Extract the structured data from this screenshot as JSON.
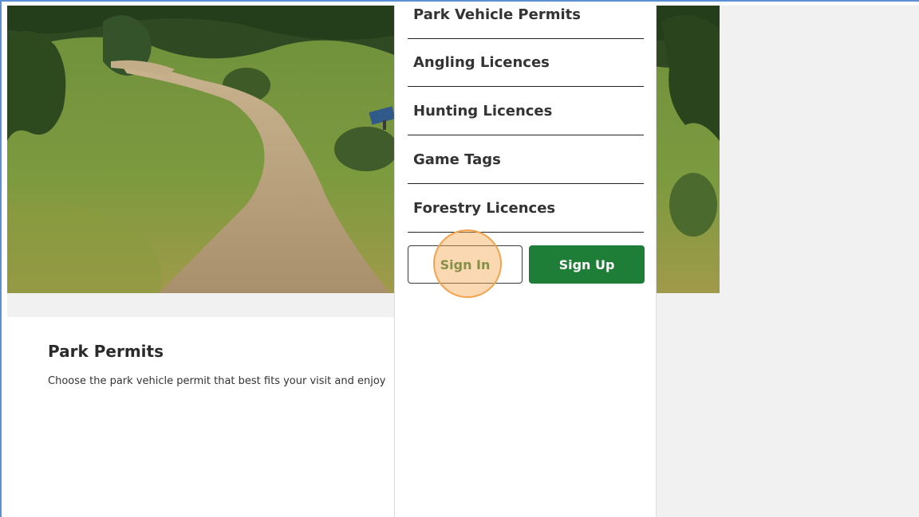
{
  "menu": {
    "items": [
      {
        "label": "Park Vehicle Permits"
      },
      {
        "label": "Angling Licences"
      },
      {
        "label": "Hunting Licences"
      },
      {
        "label": "Game Tags"
      },
      {
        "label": "Forestry Licences"
      }
    ],
    "sign_in_label": "Sign In",
    "sign_up_label": "Sign Up"
  },
  "content": {
    "title": "Park Permits",
    "description": "Choose the park vehicle permit that best fits your visit and enjoy"
  },
  "colors": {
    "brand_green": "#1e7d36",
    "sign_in_text": "#2b7a3b",
    "highlight": "#f4a24e"
  }
}
